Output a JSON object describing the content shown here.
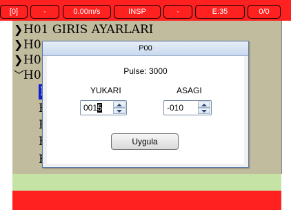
{
  "status_bar": {
    "items": [
      "[0]",
      "-",
      "0.00m/s",
      "INSP",
      "-",
      "E:35",
      "0/0"
    ],
    "background_color": "#FF2020"
  },
  "menu": {
    "background_color": "#C2BC9F",
    "items": [
      {
        "label": "H01 GIRIS AYARLARI",
        "expanded": false
      },
      {
        "label": "H0",
        "expanded": false
      },
      {
        "label": "H0",
        "expanded": false
      },
      {
        "label": "H0",
        "expanded": true
      }
    ],
    "subitems": [
      "P",
      "F",
      "F",
      "F",
      "F"
    ],
    "selected_subitem_index": 0
  },
  "footer": {
    "green_bar_color": "#C4E3A4",
    "red_bar_color": "#FF2020"
  },
  "dialog": {
    "title": "P00",
    "pulse_text": "Pulse: 3000",
    "yukari": {
      "label": "YUKARI",
      "value_prefix": "001",
      "value_cursor": "5"
    },
    "asagi": {
      "label": "ASAGI",
      "value": "-010"
    },
    "apply_button": "Uygula"
  }
}
